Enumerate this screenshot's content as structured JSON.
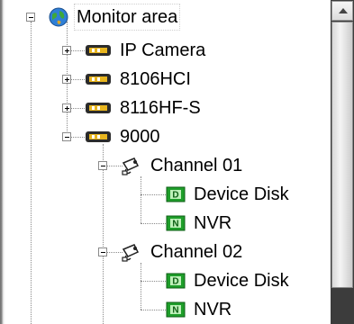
{
  "tree": {
    "root": {
      "label": "Monitor area",
      "icon": "globe-icon",
      "expanded": true,
      "selected": true
    },
    "devices": [
      {
        "label": "IP Camera",
        "icon": "device-icon",
        "expanded": false
      },
      {
        "label": "8106HCI",
        "icon": "device-icon",
        "expanded": false
      },
      {
        "label": "8116HF-S",
        "icon": "device-icon",
        "expanded": false
      },
      {
        "label": "9000",
        "icon": "device-icon",
        "expanded": true
      }
    ],
    "channels": [
      {
        "label": "Channel 01",
        "icon": "camera-icon",
        "expanded": true,
        "children": [
          {
            "label": "Device Disk",
            "icon": "storage-d-icon",
            "badge": "D"
          },
          {
            "label": "NVR",
            "icon": "storage-n-icon",
            "badge": "N"
          }
        ]
      },
      {
        "label": "Channel 02",
        "icon": "camera-icon",
        "expanded": true,
        "children": [
          {
            "label": "Device Disk",
            "icon": "storage-d-icon",
            "badge": "D"
          },
          {
            "label": "NVR",
            "icon": "storage-n-icon",
            "badge": "N"
          }
        ]
      }
    ]
  },
  "colors": {
    "storage_green": "#1e9e2a",
    "scrollbar_track": "#3c3c3c"
  }
}
